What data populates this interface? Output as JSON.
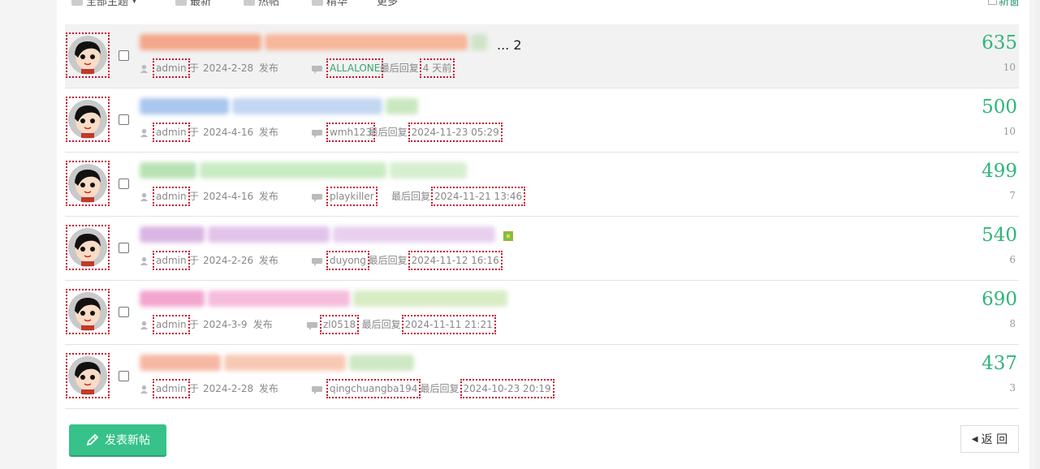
{
  "filter_bar": {
    "items": [
      "全部主题",
      "最新",
      "热帖",
      "精华",
      "更多"
    ],
    "right_label": "新窗"
  },
  "threads": [
    {
      "title_colors": [
        "#f4a78a",
        "#f6b79b",
        "#cfe3c8"
      ],
      "title_suffix": "... 2",
      "author": "admin",
      "author_sep": "于",
      "date": "2024-2-28",
      "posted_label": "发布",
      "last_replier": "ALLALONE",
      "last_reply_label": "最后回复",
      "last_time": "4 天前",
      "views": "635",
      "replies": "10",
      "highlight": true
    },
    {
      "title_colors": [
        "#a9c6ee",
        "#c3d6f2",
        "#c9e8c0"
      ],
      "title_suffix": "",
      "author": "admin",
      "author_sep": "于",
      "date": "2024-4-16",
      "posted_label": "发布",
      "last_replier": "wmh123",
      "last_reply_label": "最后回复",
      "last_time": "2024-11-23 05:29",
      "views": "500",
      "replies": "10",
      "highlight": false
    },
    {
      "title_colors": [
        "#b8e2b3",
        "#c9ebc3",
        "#d6efd0"
      ],
      "title_suffix": "",
      "author": "admin",
      "author_sep": "于",
      "date": "2024-4-16",
      "posted_label": "发布",
      "last_replier": "playkiller",
      "last_reply_label": "最后回复",
      "last_time": "2024-11-21 13:46",
      "views": "499",
      "replies": "7",
      "highlight": false
    },
    {
      "title_colors": [
        "#d9b5e3",
        "#e2c3ea",
        "#e8d0ee"
      ],
      "title_suffix": "",
      "author": "admin",
      "author_sep": "于",
      "date": "2024-2-26",
      "posted_label": "发布",
      "last_replier": "duyong",
      "last_reply_label": "最后回复",
      "last_time": "2024-11-12 16:16",
      "views": "540",
      "replies": "6",
      "highlight": false
    },
    {
      "title_colors": [
        "#f2a6cf",
        "#f5bcdb",
        "#d8ecc4"
      ],
      "title_suffix": "",
      "author": "admin",
      "author_sep": "于",
      "date": "2024-3-9",
      "posted_label": "发布",
      "last_replier": "zl0518",
      "last_reply_label": "最后回复",
      "last_time": "2024-11-11 21:21",
      "views": "690",
      "replies": "8",
      "highlight": false
    },
    {
      "title_colors": [
        "#f5b8a3",
        "#f8c9b5",
        "#cfe8c4"
      ],
      "title_suffix": "",
      "author": "admin",
      "author_sep": "于",
      "date": "2024-2-28",
      "posted_label": "发布",
      "last_replier": "qingchuangba194",
      "last_reply_label": "最后回复",
      "last_time": "2024-10-23 20:19",
      "views": "437",
      "replies": "3",
      "highlight": false
    }
  ],
  "post_button_label": "发表新帖",
  "back_button_label": "返 回"
}
